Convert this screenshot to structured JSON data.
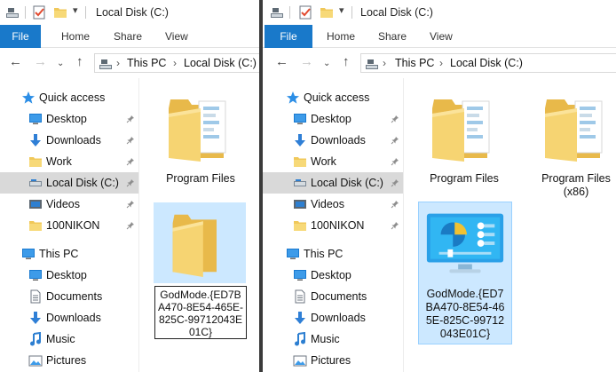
{
  "left": {
    "title": "Local Disk (C:)",
    "ribbon": {
      "file": "File",
      "home": "Home",
      "share": "Share",
      "view": "View"
    },
    "address": {
      "this_pc": "This PC",
      "local_disk": "Local Disk (C:)"
    },
    "nav": {
      "quick_access": "Quick access",
      "desktop": "Desktop",
      "downloads": "Downloads",
      "work": "Work",
      "local_disk": "Local Disk (C:)",
      "videos": "Videos",
      "nikon": "100NIKON",
      "this_pc": "This PC",
      "pc_desktop": "Desktop",
      "pc_documents": "Documents",
      "pc_downloads": "Downloads",
      "pc_music": "Music",
      "pc_pictures": "Pictures"
    },
    "items": {
      "program_files": "Program Files",
      "godmode_rename": "GodMode.{ED7BA470-8E54-465E-825C-99712043E01C}"
    }
  },
  "right": {
    "title": "Local Disk (C:)",
    "ribbon": {
      "file": "File",
      "home": "Home",
      "share": "Share",
      "view": "View"
    },
    "address": {
      "this_pc": "This PC",
      "local_disk": "Local Disk (C:)"
    },
    "nav": {
      "quick_access": "Quick access",
      "desktop": "Desktop",
      "downloads": "Downloads",
      "work": "Work",
      "local_disk": "Local Disk (C:)",
      "videos": "Videos",
      "nikon": "100NIKON",
      "this_pc": "This PC",
      "pc_desktop": "Desktop",
      "pc_documents": "Documents",
      "pc_downloads": "Downloads",
      "pc_music": "Music",
      "pc_pictures": "Pictures"
    },
    "items": {
      "program_files": "Program Files",
      "program_files_x86": "Program Files (x86)",
      "godmode": "GodMode.{ED7BA470-8E54-465E-825C-99712043E01C}"
    }
  },
  "colors": {
    "file_tab": "#1979ca",
    "selection": "#cce8ff",
    "nav_selected": "#d9d9d9",
    "folder": "#f3d36d",
    "divider": "#3a3a3a"
  }
}
